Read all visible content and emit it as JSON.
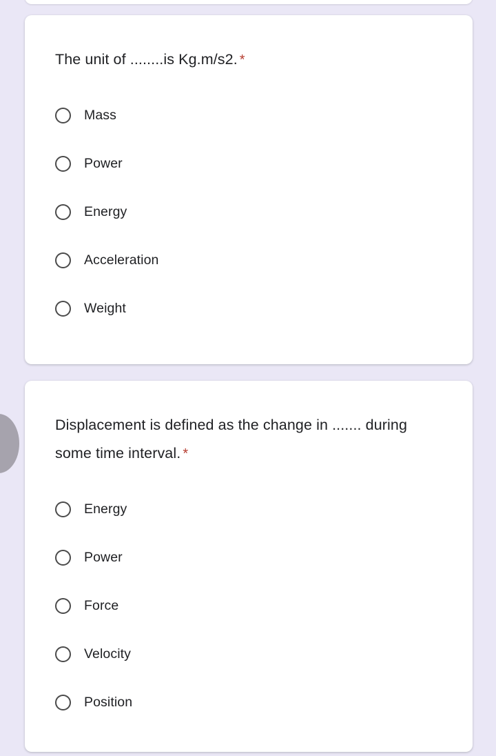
{
  "theme": {
    "page_background": "#eae7f6",
    "card_background": "#ffffff",
    "text_color": "#202124",
    "required_marker_color": "#b63e31",
    "radio_border_color": "#4a4a4a",
    "cursor_blob_color": "#a6a3ad"
  },
  "questions": [
    {
      "title": "The unit of ........is Kg.m/s2.",
      "required_marker": "*",
      "options": [
        {
          "label": "Mass",
          "selected": false
        },
        {
          "label": "Power",
          "selected": false
        },
        {
          "label": "Energy",
          "selected": false
        },
        {
          "label": "Acceleration",
          "selected": false
        },
        {
          "label": "Weight",
          "selected": false
        }
      ]
    },
    {
      "title": "Displacement is defined as the change in ....... during some time interval.",
      "required_marker": "*",
      "options": [
        {
          "label": "Energy",
          "selected": false
        },
        {
          "label": "Power",
          "selected": false
        },
        {
          "label": "Force",
          "selected": false
        },
        {
          "label": "Velocity",
          "selected": false
        },
        {
          "label": "Position",
          "selected": false
        }
      ]
    }
  ]
}
